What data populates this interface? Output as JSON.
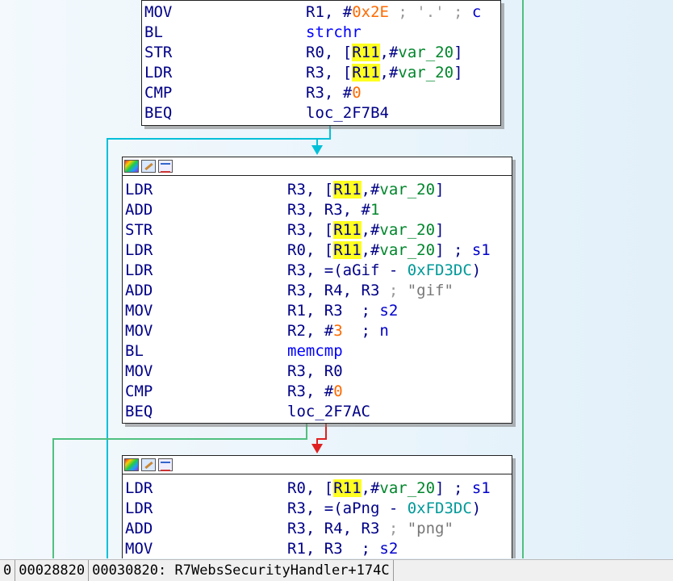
{
  "blocks": [
    {
      "id": "block-1",
      "has_header": false,
      "lines": [
        {
          "mn": "MOV",
          "ops": [
            {
              "t": "R1, #",
              "k": "reg"
            },
            {
              "t": "0x2E",
              "k": "num"
            },
            {
              "t": " ; '.' ; ",
              "k": "cmt"
            },
            {
              "t": "c",
              "k": "cmtv"
            }
          ]
        },
        {
          "mn": "BL",
          "ops": [
            {
              "t": "strchr",
              "k": "sym"
            }
          ]
        },
        {
          "mn": "STR",
          "ops": [
            {
              "t": "R0, [",
              "k": "reg"
            },
            {
              "t": "R11",
              "k": "hreg"
            },
            {
              "t": ",#",
              "k": "reg"
            },
            {
              "t": "var_20",
              "k": "var"
            },
            {
              "t": "]",
              "k": "reg"
            }
          ]
        },
        {
          "mn": "LDR",
          "ops": [
            {
              "t": "R3, [",
              "k": "reg"
            },
            {
              "t": "R11",
              "k": "hreg"
            },
            {
              "t": ",#",
              "k": "reg"
            },
            {
              "t": "var_20",
              "k": "var"
            },
            {
              "t": "]",
              "k": "reg"
            }
          ]
        },
        {
          "mn": "CMP",
          "ops": [
            {
              "t": "R3, #",
              "k": "reg"
            },
            {
              "t": "0",
              "k": "num"
            }
          ]
        },
        {
          "mn": "BEQ",
          "ops": [
            {
              "t": "loc_2F7B4",
              "k": "reg"
            }
          ]
        }
      ]
    },
    {
      "id": "block-2",
      "has_header": true,
      "lines": [
        {
          "mn": "LDR",
          "ops": [
            {
              "t": "R3, [",
              "k": "reg"
            },
            {
              "t": "R11",
              "k": "hreg"
            },
            {
              "t": ",#",
              "k": "reg"
            },
            {
              "t": "var_20",
              "k": "var"
            },
            {
              "t": "]",
              "k": "reg"
            }
          ]
        },
        {
          "mn": "ADD",
          "ops": [
            {
              "t": "R3, R3, #",
              "k": "reg"
            },
            {
              "t": "1",
              "k": "var"
            }
          ]
        },
        {
          "mn": "STR",
          "ops": [
            {
              "t": "R3, [",
              "k": "reg"
            },
            {
              "t": "R11",
              "k": "hreg"
            },
            {
              "t": ",#",
              "k": "reg"
            },
            {
              "t": "var_20",
              "k": "var"
            },
            {
              "t": "]",
              "k": "reg"
            }
          ]
        },
        {
          "mn": "LDR",
          "ops": [
            {
              "t": "R0, [",
              "k": "reg"
            },
            {
              "t": "R11",
              "k": "hreg"
            },
            {
              "t": ",#",
              "k": "reg"
            },
            {
              "t": "var_20",
              "k": "var"
            },
            {
              "t": "] ; ",
              "k": "reg"
            },
            {
              "t": "s1",
              "k": "cmtv"
            }
          ]
        },
        {
          "mn": "LDR",
          "ops": [
            {
              "t": "R3, =(aGif - ",
              "k": "reg"
            },
            {
              "t": "0xFD3DC",
              "k": "addr"
            },
            {
              "t": ")",
              "k": "reg"
            }
          ]
        },
        {
          "mn": "ADD",
          "ops": [
            {
              "t": "R3, R4, R3",
              "k": "reg"
            },
            {
              "t": " ; ",
              "k": "cmt"
            },
            {
              "t": "\"gif\"",
              "k": "str"
            }
          ]
        },
        {
          "mn": "MOV",
          "ops": [
            {
              "t": "R1, R3  ; ",
              "k": "reg"
            },
            {
              "t": "s2",
              "k": "cmtv"
            }
          ]
        },
        {
          "mn": "MOV",
          "ops": [
            {
              "t": "R2, #",
              "k": "reg"
            },
            {
              "t": "3",
              "k": "num"
            },
            {
              "t": "  ; ",
              "k": "reg"
            },
            {
              "t": "n",
              "k": "cmtv"
            }
          ]
        },
        {
          "mn": "BL",
          "ops": [
            {
              "t": "memcmp",
              "k": "sym"
            }
          ]
        },
        {
          "mn": "MOV",
          "ops": [
            {
              "t": "R3, R0",
              "k": "reg"
            }
          ]
        },
        {
          "mn": "CMP",
          "ops": [
            {
              "t": "R3, #",
              "k": "reg"
            },
            {
              "t": "0",
              "k": "num"
            }
          ]
        },
        {
          "mn": "BEQ",
          "ops": [
            {
              "t": "loc_2F7AC",
              "k": "reg"
            }
          ]
        }
      ]
    },
    {
      "id": "block-3",
      "has_header": true,
      "lines": [
        {
          "mn": "LDR",
          "ops": [
            {
              "t": "R0, [",
              "k": "reg"
            },
            {
              "t": "R11",
              "k": "hreg"
            },
            {
              "t": ",#",
              "k": "reg"
            },
            {
              "t": "var_20",
              "k": "var"
            },
            {
              "t": "] ; ",
              "k": "reg"
            },
            {
              "t": "s1",
              "k": "cmtv"
            }
          ]
        },
        {
          "mn": "LDR",
          "ops": [
            {
              "t": "R3, =(aPng - ",
              "k": "reg"
            },
            {
              "t": "0xFD3DC",
              "k": "addr"
            },
            {
              "t": ")",
              "k": "reg"
            }
          ]
        },
        {
          "mn": "ADD",
          "ops": [
            {
              "t": "R3, R4, R3",
              "k": "reg"
            },
            {
              "t": " ; ",
              "k": "cmt"
            },
            {
              "t": "\"png\"",
              "k": "str"
            }
          ]
        },
        {
          "mn": "MOV",
          "ops": [
            {
              "t": "R1, R3  ; ",
              "k": "reg"
            },
            {
              "t": "s2",
              "k": "cmtv"
            }
          ]
        }
      ]
    }
  ],
  "colors": {
    "edge_true": "#00c0d8",
    "edge_false": "#e02020",
    "edge_green": "#50c080",
    "highlight": "#ffff20"
  },
  "statusbar": {
    "segment0": "0",
    "file_offset": "00028820",
    "address_label": "00030820: R7WebsSecurityHandler+174C"
  }
}
